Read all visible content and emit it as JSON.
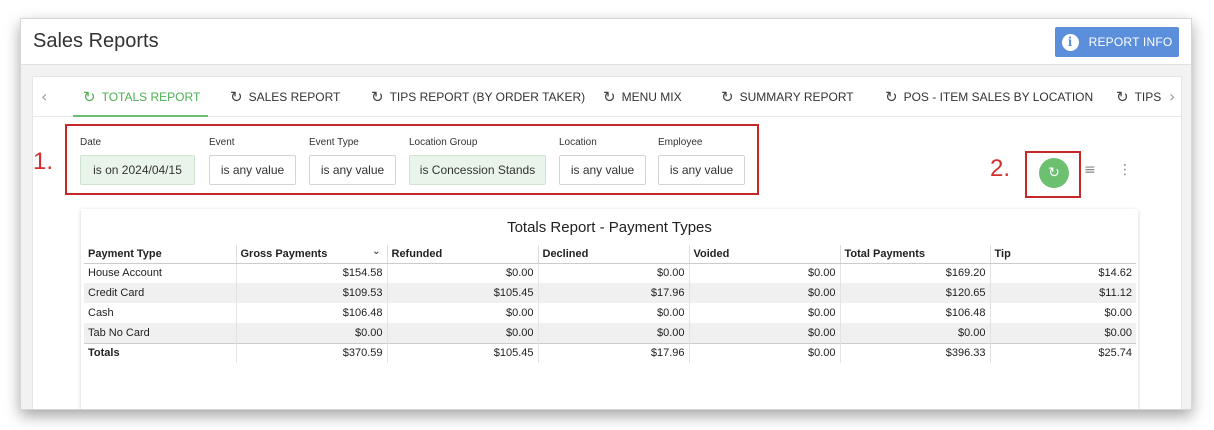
{
  "header": {
    "title": "Sales Reports",
    "report_info_label": "REPORT INFO",
    "info_icon": "i"
  },
  "tabs": [
    {
      "label": "TOTALS REPORT",
      "active": true
    },
    {
      "label": "SALES REPORT"
    },
    {
      "label": "TIPS REPORT (BY ORDER TAKER)"
    },
    {
      "label": "MENU MIX"
    },
    {
      "label": "SUMMARY REPORT"
    },
    {
      "label": "POS - ITEM SALES BY LOCATION"
    },
    {
      "label": "TIPS"
    }
  ],
  "tab_icon": "↻",
  "tab_nav": {
    "prev": "‹",
    "next": "›"
  },
  "annotations": {
    "one": "1.",
    "two": "2."
  },
  "filters": [
    {
      "label": "Date",
      "value": "is on 2024/04/15",
      "set": true
    },
    {
      "label": "Event",
      "value": "is any value"
    },
    {
      "label": "Event Type",
      "value": "is any value"
    },
    {
      "label": "Location Group",
      "value": "is Concession Stands",
      "set": true
    },
    {
      "label": "Location",
      "value": "is any value"
    },
    {
      "label": "Employee",
      "value": "is any value"
    }
  ],
  "toolbar": {
    "refresh_icon": "↻",
    "filter_icon": "≡",
    "more_icon": "⋮"
  },
  "report": {
    "title": "Totals Report - Payment Types",
    "sort_icon": "⌄",
    "columns": [
      "Payment Type",
      "Gross Payments",
      "Refunded",
      "Declined",
      "Voided",
      "Total Payments",
      "Tip"
    ],
    "rows": [
      [
        "House Account",
        "$154.58",
        "$0.00",
        "$0.00",
        "$0.00",
        "$169.20",
        "$14.62"
      ],
      [
        "Credit Card",
        "$109.53",
        "$105.45",
        "$17.96",
        "$0.00",
        "$120.65",
        "$11.12"
      ],
      [
        "Cash",
        "$106.48",
        "$0.00",
        "$0.00",
        "$0.00",
        "$106.48",
        "$0.00"
      ],
      [
        "Tab No Card",
        "$0.00",
        "$0.00",
        "$0.00",
        "$0.00",
        "$0.00",
        "$0.00"
      ]
    ],
    "totals": [
      "Totals",
      "$370.59",
      "$105.45",
      "$17.96",
      "$0.00",
      "$396.33",
      "$25.74"
    ]
  }
}
